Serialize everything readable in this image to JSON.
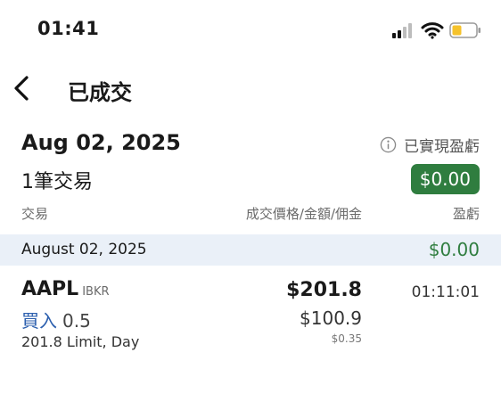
{
  "status_bar": {
    "time": "01:41",
    "icons": [
      "signal-icon",
      "wifi-icon",
      "battery-icon"
    ],
    "battery_color": "#f5c22b"
  },
  "nav": {
    "title": "已成交",
    "back_icon": "chevron-left-icon"
  },
  "summary": {
    "date": "Aug 02, 2025",
    "realized_label": "已實現盈虧",
    "trade_count": "1筆交易",
    "realized_pnl": "$0.00"
  },
  "columns": {
    "trade": "交易",
    "price_amount_commission": "成交價格/金額/佣金",
    "pnl": "盈虧"
  },
  "groups": [
    {
      "date": "August 02, 2025",
      "pnl": "$0.00",
      "trades": [
        {
          "symbol": "AAPL",
          "broker": "IBKR",
          "side": "買入",
          "quantity": "0.5",
          "order": "201.8 Limit, Day",
          "price": "$201.8",
          "amount": "$100.9",
          "commission": "$0.35",
          "time": "01:11:01"
        }
      ]
    }
  ],
  "colors": {
    "positive": "#2f7d3f",
    "buy": "#2c5fae",
    "group_band": "#eaf0f8"
  }
}
